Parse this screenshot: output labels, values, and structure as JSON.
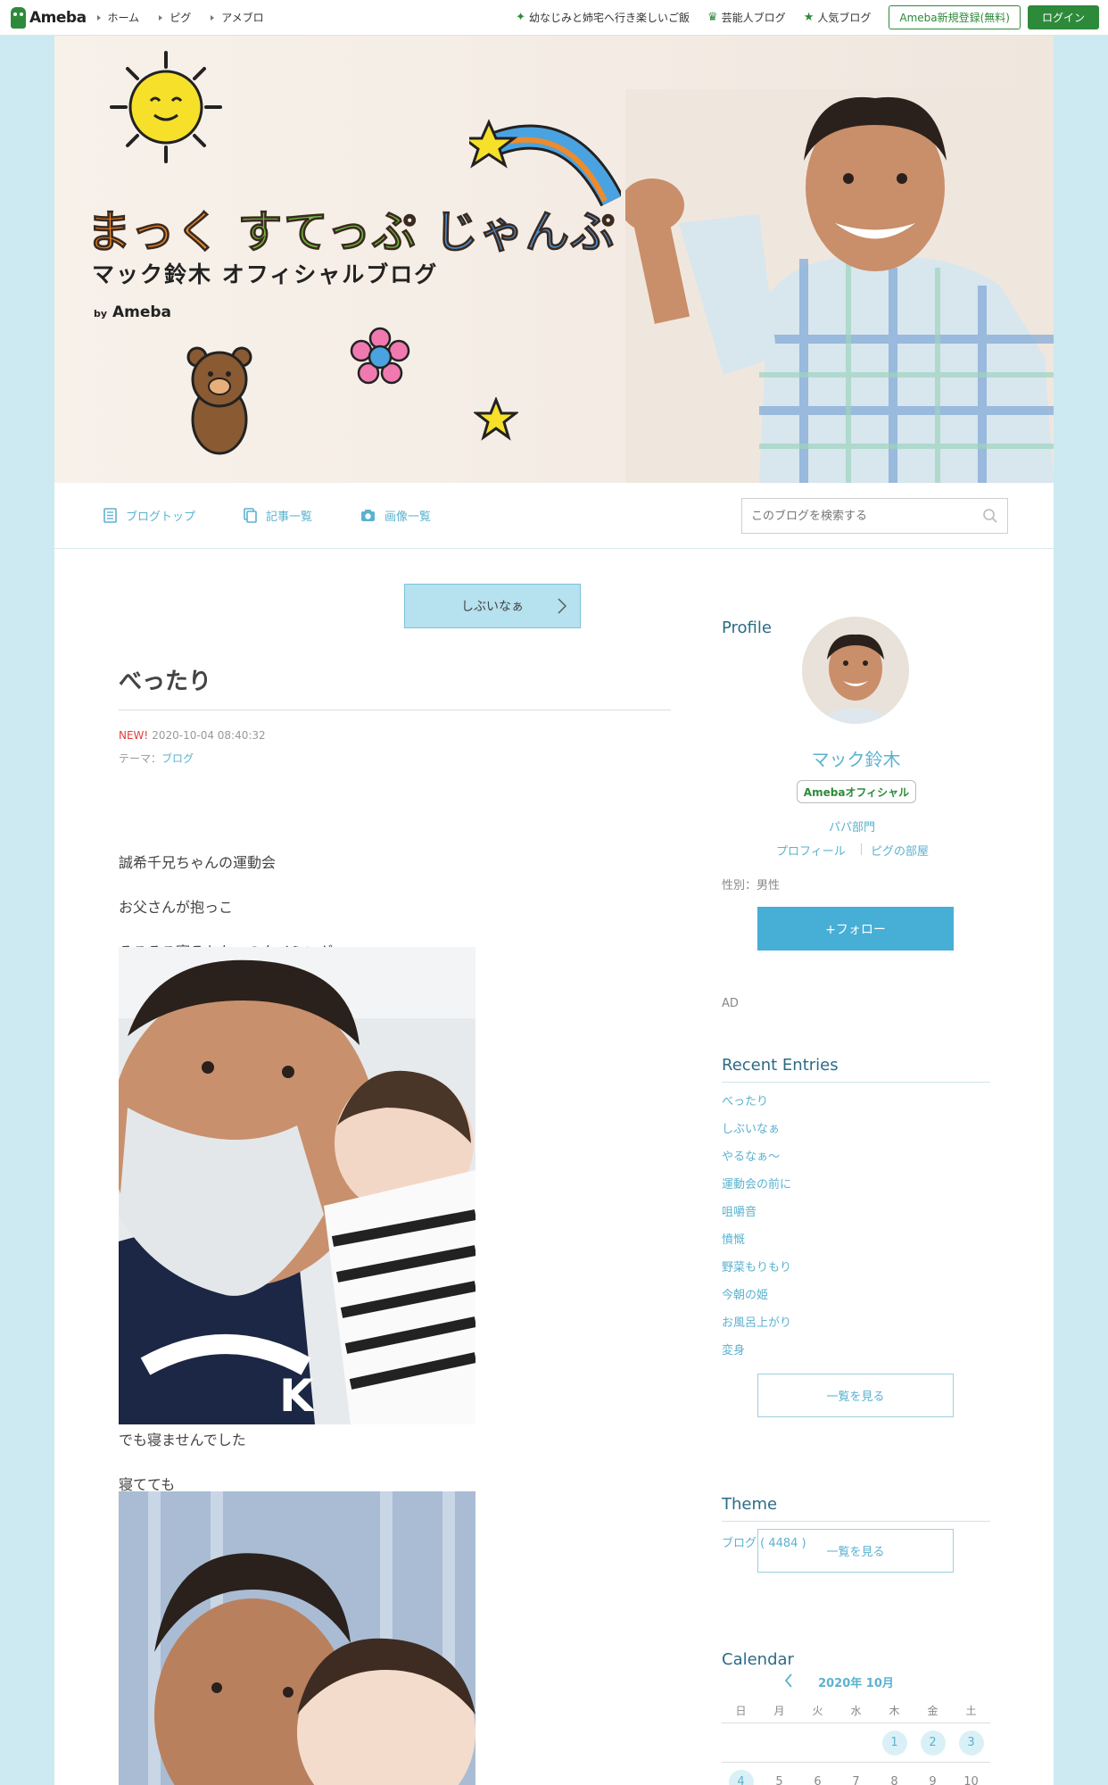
{
  "topbar": {
    "logo": "Ameba",
    "nav": [
      "ホーム",
      "ピグ",
      "アメブロ"
    ],
    "links": [
      "幼なじみと姉宅へ行き楽しいご飯",
      "芸能人ブログ",
      "人気ブログ"
    ],
    "register": "Ameba新規登録(無料)",
    "login": "ログイン"
  },
  "banner": {
    "title_a": "まっく",
    "title_b": "すてっぷ",
    "title_c": "じゃんぷ",
    "subtitle": "マック鈴木 オフィシャルブログ",
    "by": "by",
    "brand": "Ameba"
  },
  "blognav": {
    "items": [
      "ブログトップ",
      "記事一覧",
      "画像一覧"
    ],
    "search_placeholder": "このブログを検索する"
  },
  "entry": {
    "next_label": "しぶいなぁ",
    "title": "べったり",
    "new_label": "NEW!",
    "datetime": "2020-10-04 08:40:32",
    "theme_label": "テーマ：",
    "theme": "ブログ",
    "paragraphs": [
      "誠希千兄ちゃんの運動会",
      "お父さんが抱っこ",
      "そろそろ寝るかなぁのタイミング",
      "でも寝ませんでした",
      "寝てても"
    ]
  },
  "sidebar": {
    "profile_heading": "Profile",
    "name": "マック鈴木",
    "badge": "Amebaオフィシャル",
    "category": "パパ部門",
    "profile_link": "プロフィール",
    "pig_link": "ピグの部屋",
    "gender": "性別：男性",
    "follow": "+フォロー",
    "ad": "AD",
    "recent_heading": "Recent Entries",
    "recent": [
      "べったり",
      "しぶいなぁ",
      "やるなぁ〜",
      "運動会の前に",
      "咀嚼音",
      "憤慨",
      "野菜もりもり",
      "今朝の姫",
      "お風呂上がり",
      "変身"
    ],
    "more1": "一覧を見る",
    "theme_heading": "Theme",
    "theme_item": "ブログ ( 4484 )",
    "more2": "一覧を見る",
    "calendar_heading": "Calendar",
    "calendar_month": "2020年 10月",
    "weekdays": [
      "日",
      "月",
      "火",
      "水",
      "木",
      "金",
      "土"
    ],
    "week1": [
      "",
      "",
      "",
      "",
      "1",
      "2",
      "3"
    ],
    "week2": [
      "4",
      "5",
      "6",
      "7",
      "8",
      "9",
      "10"
    ]
  }
}
